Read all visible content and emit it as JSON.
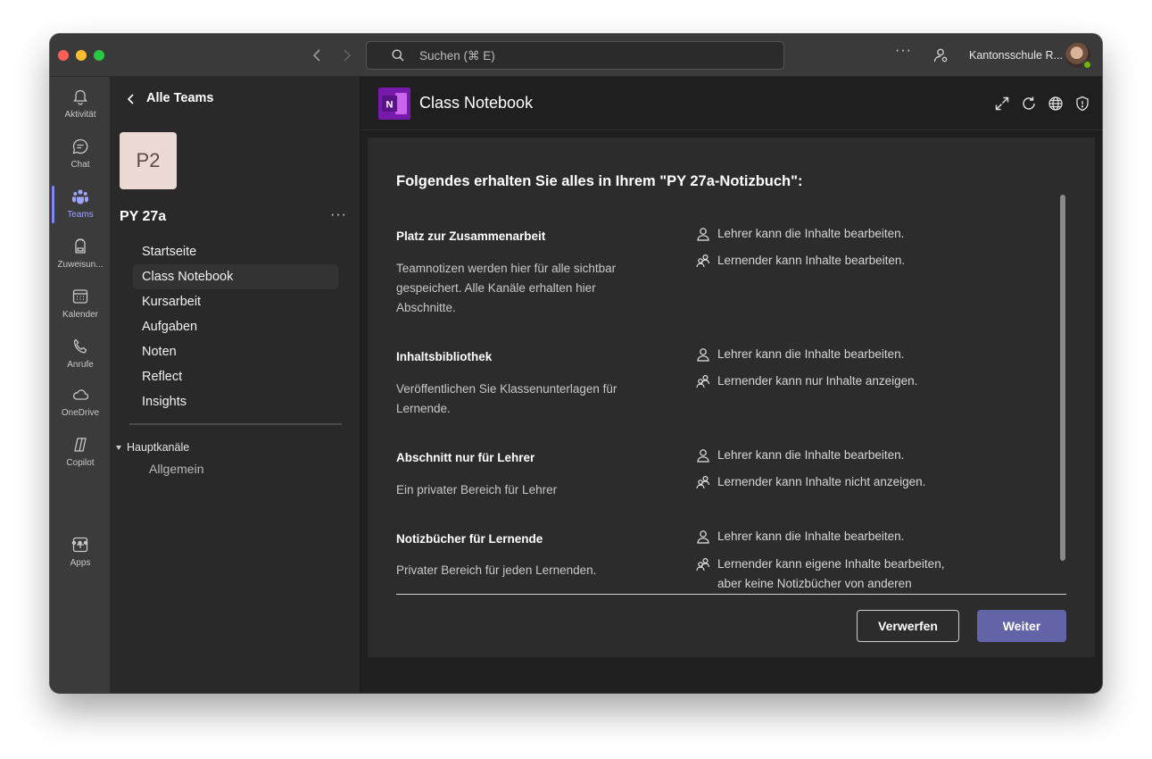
{
  "window": {
    "search_placeholder": "Suchen (⌘ E)",
    "more_label": "···",
    "org_name": "Kantonsschule R...",
    "presence": "available"
  },
  "rail": {
    "items": [
      {
        "label": "Aktivität",
        "icon": "bell-icon"
      },
      {
        "label": "Chat",
        "icon": "chat-icon"
      },
      {
        "label": "Teams",
        "icon": "teams-icon",
        "active": true
      },
      {
        "label": "Zuweisun...",
        "icon": "backpack-icon"
      },
      {
        "label": "Kalender",
        "icon": "calendar-icon"
      },
      {
        "label": "Anrufe",
        "icon": "phone-icon"
      },
      {
        "label": "OneDrive",
        "icon": "cloud-icon"
      },
      {
        "label": "Copilot",
        "icon": "copilot-icon"
      }
    ],
    "more": "•••",
    "apps_label": "Apps"
  },
  "panel": {
    "back_label": "Alle Teams",
    "team_initials": "P2",
    "team_name": "PY 27a",
    "more": "···",
    "nav": [
      "Startseite",
      "Class Notebook",
      "Kursarbeit",
      "Aufgaben",
      "Noten",
      "Reflect",
      "Insights"
    ],
    "active_nav": "Class Notebook",
    "channels_header": "Hauptkanäle",
    "channels": [
      "Allgemein"
    ]
  },
  "main": {
    "app_title": "Class Notebook",
    "header_icons": [
      "expand-icon",
      "refresh-icon",
      "globe-icon",
      "shield-icon"
    ],
    "card_title": "Folgendes erhalten Sie alles in Ihrem \"PY 27a-Notizbuch\":",
    "sections": [
      {
        "title": "Platz zur Zusammenarbeit",
        "desc": "Teamnotizen werden hier für alle sichtbar gespeichert. Alle Kanäle erhalten hier Abschnitte.",
        "teacher": "Lehrer kann die Inhalte bearbeiten.",
        "student": "Lernender kann Inhalte bearbeiten."
      },
      {
        "title": "Inhaltsbibliothek",
        "desc": "Veröffentlichen Sie Klassenunterlagen für Lernende.",
        "teacher": "Lehrer kann die Inhalte bearbeiten.",
        "student": "Lernender kann nur Inhalte anzeigen."
      },
      {
        "title": "Abschnitt nur für Lehrer",
        "desc": "Ein privater Bereich für Lehrer",
        "teacher": "Lehrer kann die Inhalte bearbeiten.",
        "student": "Lernender kann Inhalte nicht anzeigen."
      },
      {
        "title": "Notizbücher für Lernende",
        "desc": "Privater Bereich für jeden Lernenden.",
        "teacher": "Lehrer kann die Inhalte bearbeiten.",
        "student": "Lernender kann eigene Inhalte bearbeiten, aber keine Notizbücher von anderen"
      }
    ],
    "btn_discard": "Verwerfen",
    "btn_next": "Weiter"
  },
  "colors": {
    "accent": "#6264a7",
    "rail_active": "#9da3ff",
    "onenote": "#7719aa"
  }
}
